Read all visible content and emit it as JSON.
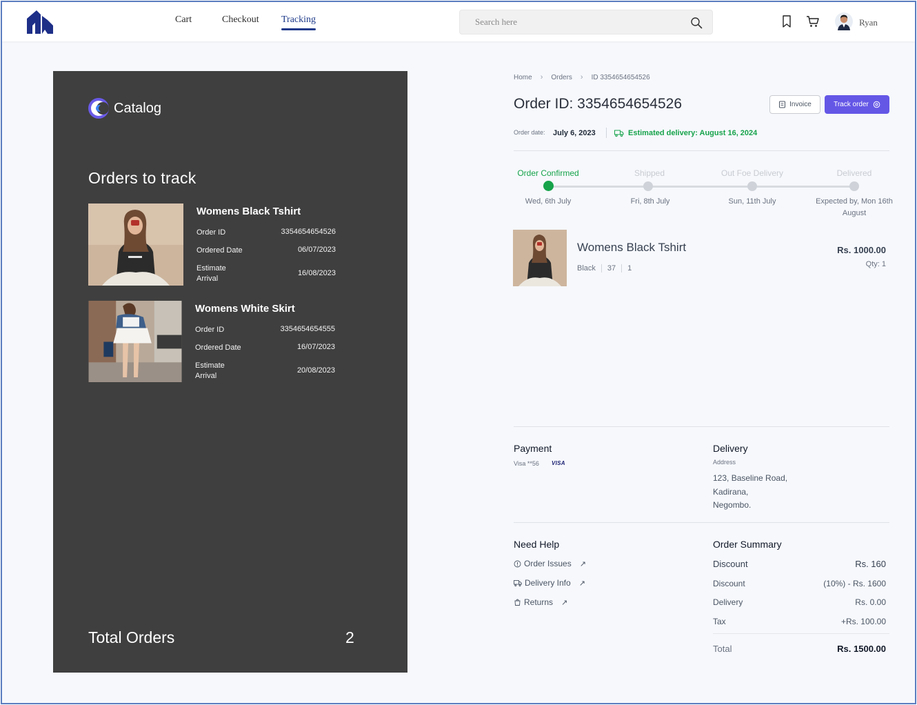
{
  "nav": {
    "links": [
      {
        "label": "Cart"
      },
      {
        "label": "Checkout"
      },
      {
        "label": "Tracking"
      }
    ],
    "search_placeholder": "Search here",
    "user_name": "Ryan",
    "icons": [
      "bookmark-icon",
      "cart-icon",
      "search-icon"
    ]
  },
  "left_panel": {
    "brand": "Catalog",
    "title": "Orders to track",
    "orders": [
      {
        "name": "Womens Black Tshirt",
        "order_id_label": "Order ID",
        "order_id": "3354654654526",
        "ordered_date_label": "Ordered Date",
        "ordered_date": "06/07/2023",
        "estimate_label_1": "Estimate",
        "estimate_label_2": "Arrival",
        "estimate_arrival": "16/08/2023"
      },
      {
        "name": "Womens White Skirt",
        "order_id_label": "Order ID",
        "order_id": "3354654654555",
        "ordered_date_label": "Ordered Date",
        "ordered_date": "16/07/2023",
        "estimate_label_1": "Estimate",
        "estimate_label_2": "Arrival",
        "estimate_arrival": "20/08/2023"
      }
    ],
    "total_label": "Total Orders",
    "total_value": "2"
  },
  "detail": {
    "breadcrumb": [
      "Home",
      "Orders",
      "ID 3354654654526"
    ],
    "order_title": "Order ID: 3354654654526",
    "invoice_label": "Invoice",
    "track_label": "Track order",
    "order_date_label": "Order date:",
    "order_date": "July 6, 2023",
    "estimated_delivery": "Estimated delivery: August 16, 2024",
    "steps": [
      {
        "label": "Order Confirmed",
        "date": "Wed, 6th July",
        "done": true
      },
      {
        "label": "Shipped",
        "date": "Fri, 8th July",
        "done": false
      },
      {
        "label": "Out Foe Delivery",
        "date": "Sun, 11th July",
        "done": false
      },
      {
        "label": "Delivered",
        "date": "Expected by, Mon 16th August",
        "done": false
      }
    ],
    "item": {
      "name": "Womens Black Tshirt",
      "color": "Black",
      "size": "37",
      "quantity": "1",
      "price": "Rs. 1000.00",
      "qty_label": "Qty: 1"
    },
    "payment": {
      "title": "Payment",
      "card": "Visa **56",
      "brand": "VISA"
    },
    "delivery": {
      "title": "Delivery",
      "address_label": "Address",
      "address_lines": [
        "123, Baseline Road,",
        "Kadirana,",
        "Negombo."
      ]
    },
    "help": {
      "title": "Need Help",
      "links": [
        "Order Issues",
        "Delivery Info",
        "Returns"
      ]
    },
    "summary": {
      "title": "Order Summary",
      "rows": [
        {
          "label": "Discount",
          "value": "Rs. 160"
        },
        {
          "label": "Discount",
          "value": "(10%) - Rs. 1600"
        },
        {
          "label": "Delivery",
          "value": "Rs. 0.00"
        },
        {
          "label": "Tax",
          "value": "+Rs. 100.00"
        }
      ],
      "total_label": "Total",
      "total_value": "Rs. 1500.00"
    }
  },
  "colors": {
    "accent": "#6557e6",
    "success": "#16a34a",
    "navy": "#1e3a8a",
    "panel": "#3f3f3f"
  }
}
